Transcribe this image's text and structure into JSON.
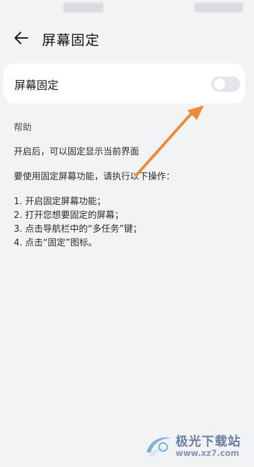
{
  "colors": {
    "background": "#f1f3f5",
    "card": "#ffffff",
    "toggle_off": "#e3e5e8",
    "annotation_arrow": "#ee8a33",
    "watermark": "#6b7fa6"
  },
  "header": {
    "back_icon": "arrow-left-icon",
    "title": "屏幕固定"
  },
  "setting": {
    "label": "屏幕固定",
    "toggle_state": "off"
  },
  "help": {
    "title": "帮助",
    "line1": "开启后，可以固定显示当前界面",
    "line2": "要使用固定屏幕功能，请执行以下操作：",
    "steps": [
      "1. 开启固定屏幕功能；",
      "2. 打开您想要固定的屏幕；",
      "3. 点击导航栏中的“多任务”键；",
      "4. 点击“固定”图标。"
    ]
  },
  "annotation": {
    "icon": "orange-arrow-annotation"
  },
  "watermark": {
    "name": "极光下载站",
    "url": "www.xz7.com",
    "icon": "xz7-logo-icon"
  }
}
